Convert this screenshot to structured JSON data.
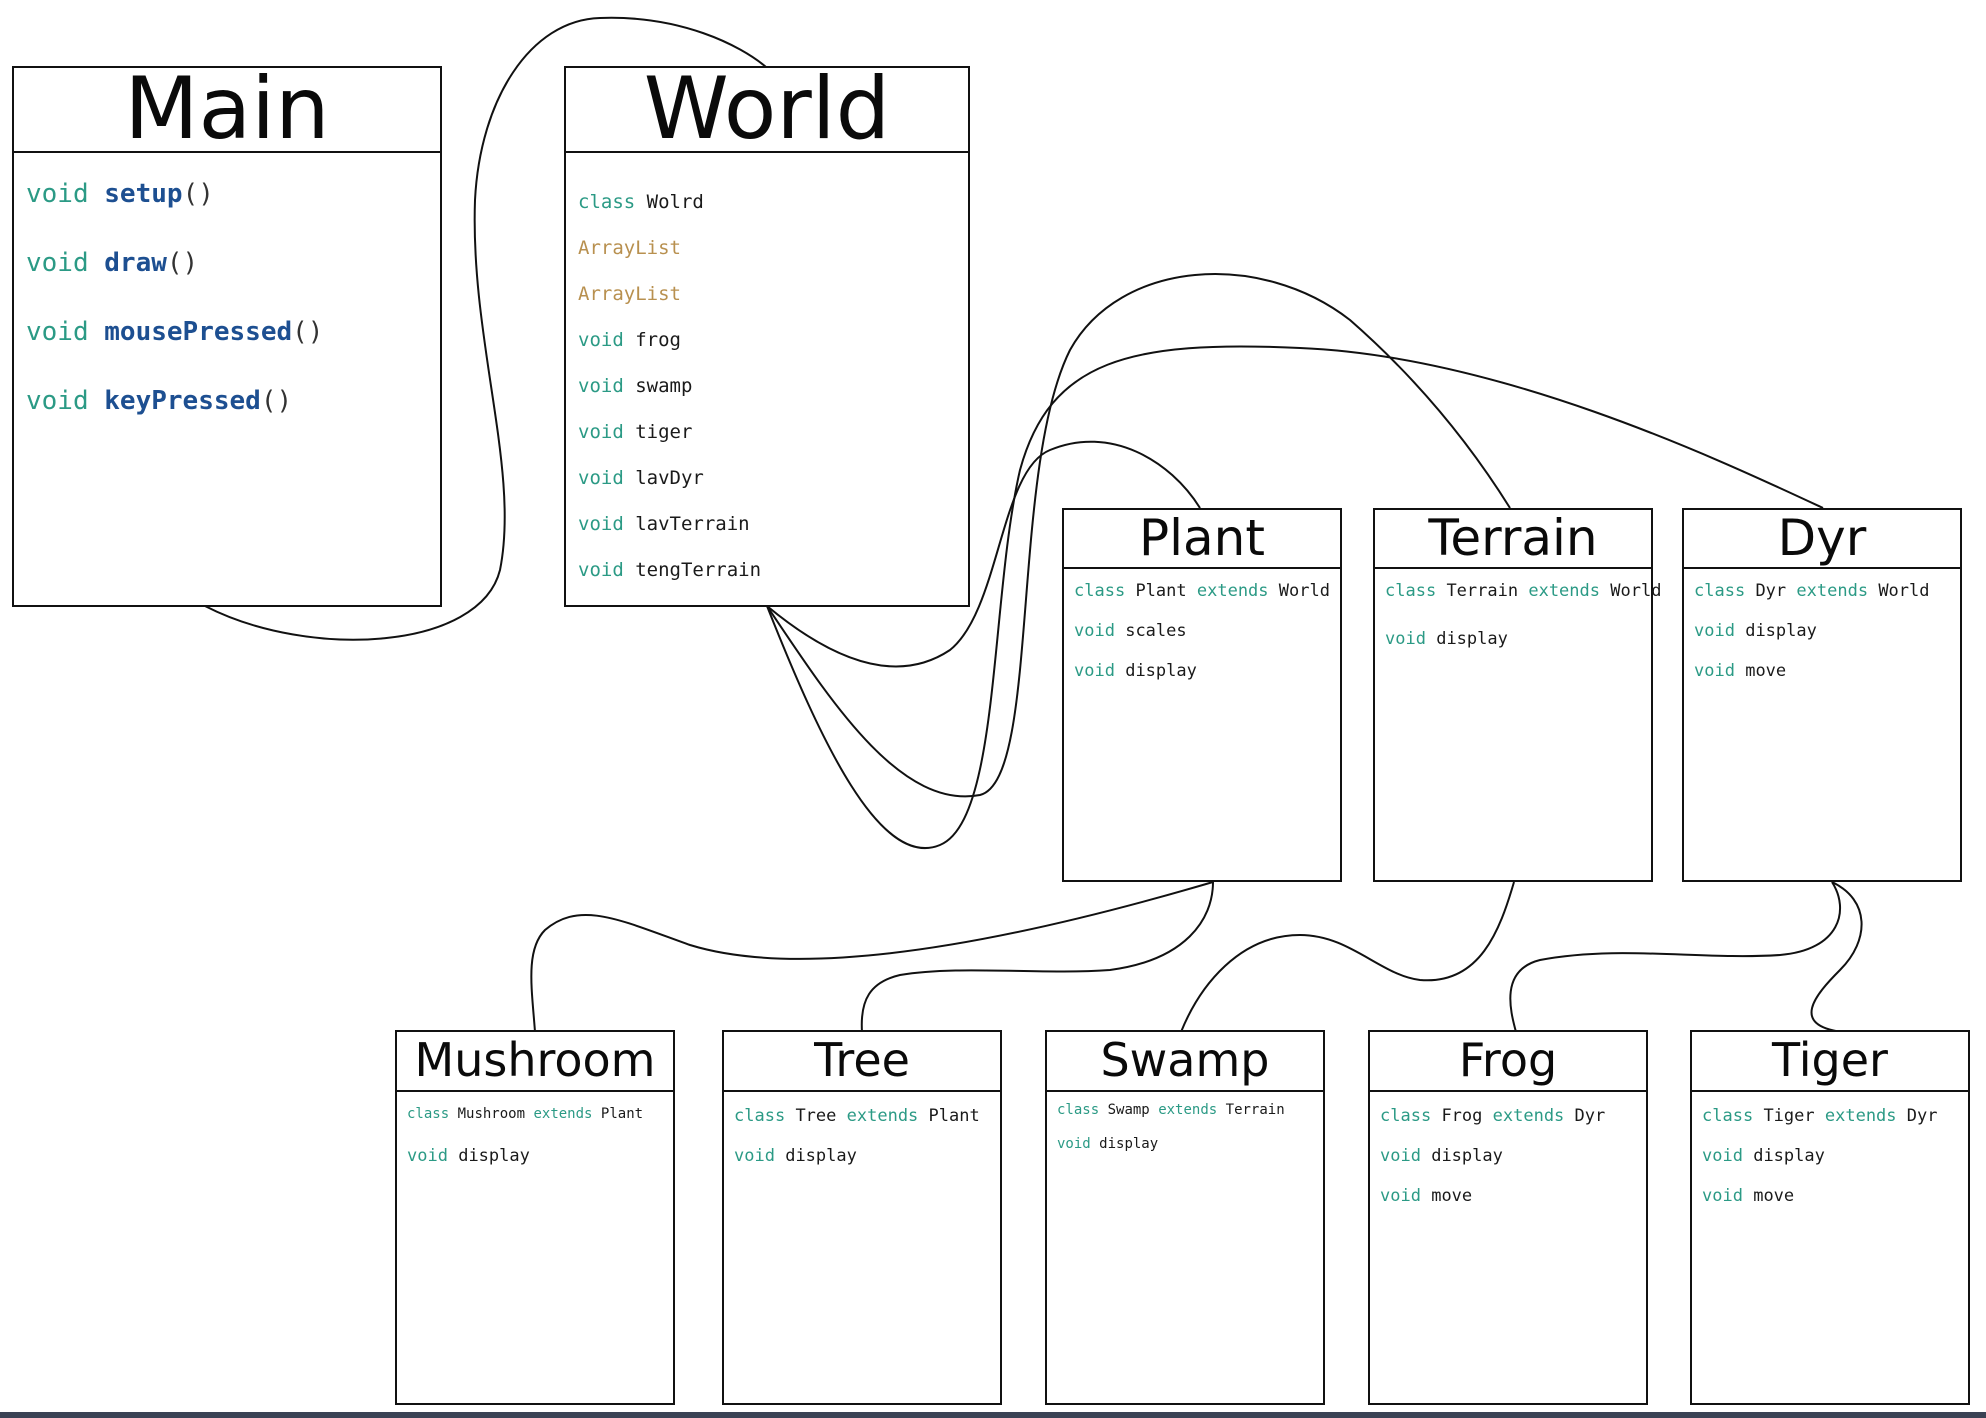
{
  "main": {
    "title": "Main",
    "methods": [
      {
        "kw": "void",
        "name": "setup",
        "parens": "()"
      },
      {
        "kw": "void",
        "name": "draw",
        "parens": "()"
      },
      {
        "kw": "void",
        "name": "mousePressed",
        "parens": "()"
      },
      {
        "kw": "void",
        "name": "keyPressed",
        "parens": "()"
      }
    ]
  },
  "world": {
    "title": "World",
    "lines": [
      {
        "kw": "class",
        "text": "Wolrd"
      },
      {
        "type": "ArrayList"
      },
      {
        "type": "ArrayList"
      },
      {
        "kw": "void",
        "text": "frog"
      },
      {
        "kw": "void",
        "text": "swamp"
      },
      {
        "kw": "void",
        "text": "tiger"
      },
      {
        "kw": "void",
        "text": "lavDyr"
      },
      {
        "kw": "void",
        "text": "lavTerrain"
      },
      {
        "kw": "void",
        "text": "tengTerrain"
      }
    ]
  },
  "plant": {
    "title": "Plant",
    "decl": {
      "kw": "class",
      "name": "Plant",
      "ext": "extends",
      "parent": "World"
    },
    "methods": [
      {
        "kw": "void",
        "text": "scales"
      },
      {
        "kw": "void",
        "text": "display"
      }
    ]
  },
  "terrain": {
    "title": "Terrain",
    "decl": {
      "kw": "class",
      "name": "Terrain",
      "ext": "extends",
      "parent": "World"
    },
    "methods": [
      {
        "kw": "void",
        "text": "display"
      }
    ]
  },
  "dyr": {
    "title": "Dyr",
    "decl": {
      "kw": "class",
      "name": "Dyr",
      "ext": "extends",
      "parent": "World"
    },
    "methods": [
      {
        "kw": "void",
        "text": "display"
      },
      {
        "kw": "void",
        "text": "move"
      }
    ]
  },
  "mushroom": {
    "title": "Mushroom",
    "decl": {
      "kw": "class",
      "name": "Mushroom",
      "ext": "extends",
      "parent": "Plant"
    },
    "methods": [
      {
        "kw": "void",
        "text": "display"
      }
    ]
  },
  "tree": {
    "title": "Tree",
    "decl": {
      "kw": "class",
      "name": "Tree",
      "ext": "extends",
      "parent": "Plant"
    },
    "methods": [
      {
        "kw": "void",
        "text": "display"
      }
    ]
  },
  "swamp": {
    "title": "Swamp",
    "decl": {
      "kw": "class",
      "name": "Swamp",
      "ext": "extends",
      "parent": "Terrain"
    },
    "methods": [
      {
        "kw": "void",
        "text": "display"
      }
    ]
  },
  "frog": {
    "title": "Frog",
    "decl": {
      "kw": "class",
      "name": "Frog",
      "ext": "extends",
      "parent": "Dyr"
    },
    "methods": [
      {
        "kw": "void",
        "text": "display"
      },
      {
        "kw": "void",
        "text": "move"
      }
    ]
  },
  "tiger": {
    "title": "Tiger",
    "decl": {
      "kw": "class",
      "name": "Tiger",
      "ext": "extends",
      "parent": "Dyr"
    },
    "methods": [
      {
        "kw": "void",
        "text": "display"
      },
      {
        "kw": "void",
        "text": "move"
      }
    ]
  },
  "colors": {
    "keyword": "#2b9a85",
    "function": "#1d4f91",
    "type": "#b8904f",
    "line": "#111111"
  }
}
